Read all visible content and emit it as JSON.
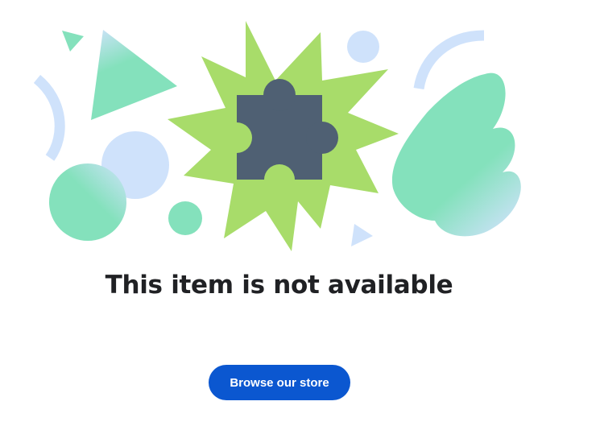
{
  "error": {
    "title": "This item is not available",
    "cta_label": "Browse our store"
  },
  "illustration": {
    "icon": "puzzle-piece-icon",
    "colors": {
      "burst": "#a8dc6a",
      "puzzle": "#4f6073",
      "mint": "#84e1bc",
      "light_blue": "#cfe2fb",
      "button": "#0b57d0"
    }
  }
}
